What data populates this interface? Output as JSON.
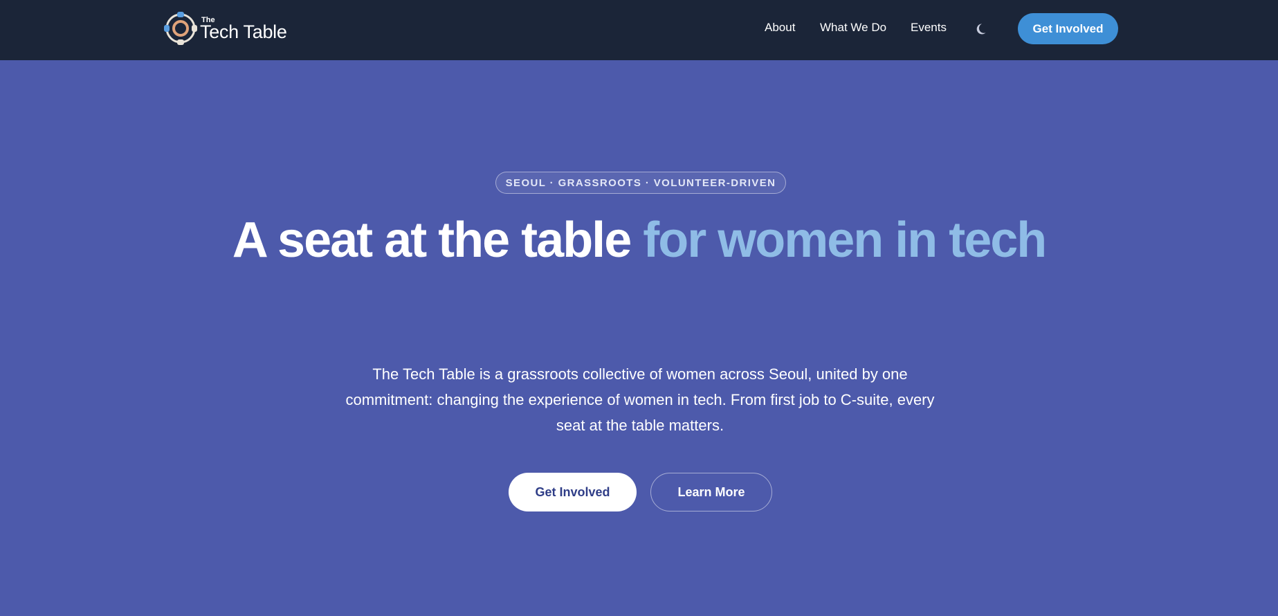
{
  "header": {
    "logo": {
      "small_text": "The",
      "big_text": "Tech Table",
      "icon": "tech-table-logo-icon"
    },
    "nav": {
      "items": [
        {
          "label": "About"
        },
        {
          "label": "What We Do"
        },
        {
          "label": "Events"
        }
      ],
      "theme_toggle_icon": "moon-icon",
      "cta_label": "Get Involved"
    }
  },
  "hero": {
    "badge": "SEOUL · GRASSROOTS · VOLUNTEER-DRIVEN",
    "headline_plain": "A seat at the table ",
    "headline_accent": "for women in tech",
    "subtext": "The Tech Table is a grassroots collective of women across Seoul, united by one commitment: changing the experience of women in tech. From first job to C-suite, every seat at the table matters.",
    "primary_button": "Get Involved",
    "secondary_button": "Learn More"
  },
  "colors": {
    "header_bg": "#1b2538",
    "hero_bg": "#4d5aab",
    "accent": "#8fbce6",
    "cta_blue": "#3e8fd6",
    "primary_button_text": "#2f3d87"
  }
}
